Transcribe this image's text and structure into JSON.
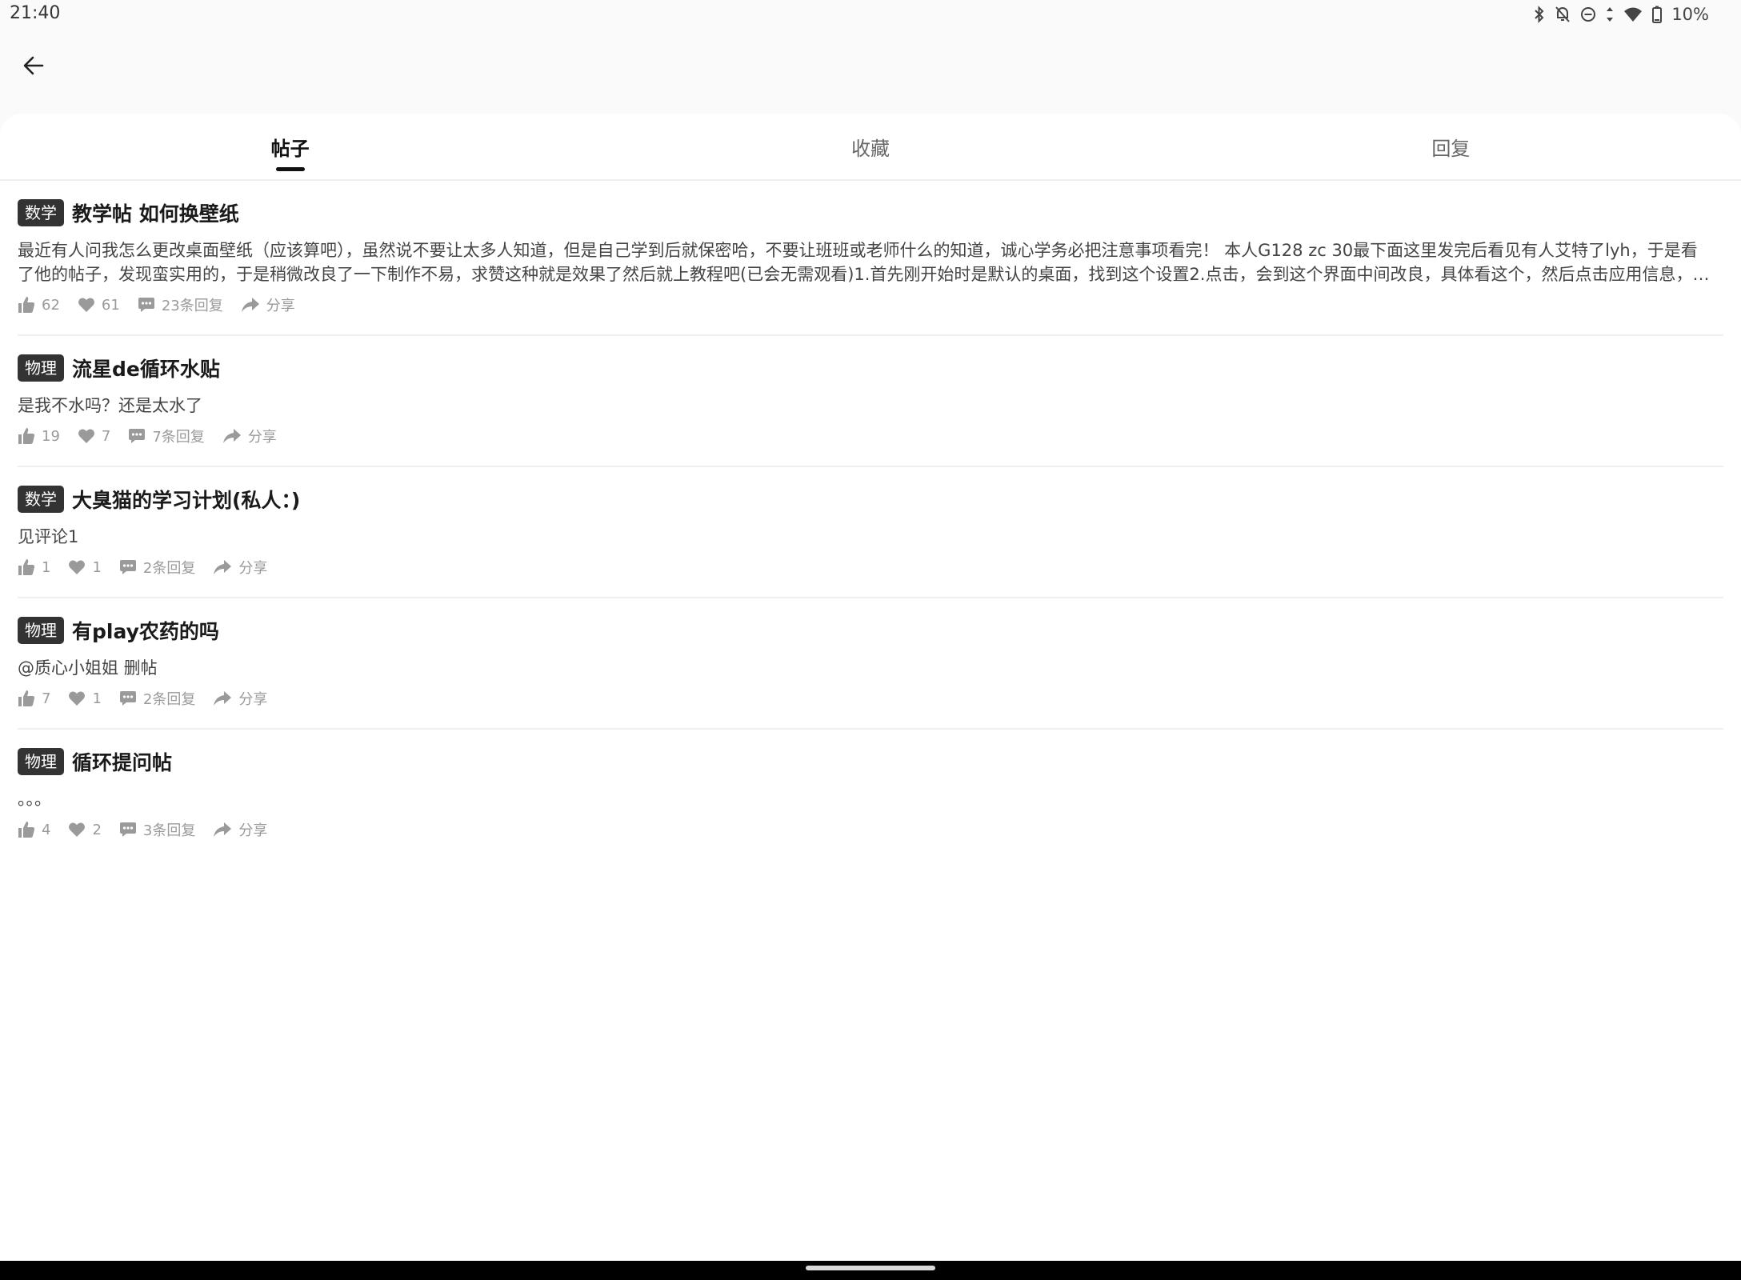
{
  "status_bar": {
    "time": "21:40",
    "battery_text": "10%",
    "icons": [
      "bluetooth-icon",
      "bell-off-icon",
      "do-not-disturb-icon",
      "data-arrows-icon",
      "wifi-icon",
      "battery-icon"
    ]
  },
  "app_bar": {
    "back_icon": "arrow-left-icon"
  },
  "tabs": [
    {
      "label": "帖子",
      "active": true
    },
    {
      "label": "收藏",
      "active": false
    },
    {
      "label": "回复",
      "active": false
    }
  ],
  "posts": [
    {
      "tag": "数学",
      "title": "教学帖  如何换壁纸",
      "body": "最近有人问我怎么更改桌面壁纸（应该算吧），虽然说不要让太多人知道，但是自己学到后就保密哈，不要让班班或老师什么的知道，诚心学务必把注意事项看完！   本人G128      zc 30最下面这里发完后看见有人艾特了lyh，于是看了他的帖子，发现蛮实用的，于是稍微改良了一下制作不易，求赞这种就是效果了然后就上教程吧(已会无需观看)1.首先刚开始时是默认的桌面，找到这个设置2.点击，会到这个界面中间改良，具体看这个，然后点击应用信息，就…",
      "likes": "62",
      "favorites": "61",
      "replies": "23条回复",
      "share": "分享"
    },
    {
      "tag": "物理",
      "title": "流星de循环水贴",
      "body": "是我不水吗？还是太水了",
      "likes": "19",
      "favorites": "7",
      "replies": "7条回复",
      "share": "分享"
    },
    {
      "tag": "数学",
      "title": "大臭猫的学习计划(私人：)",
      "body": "见评论1",
      "likes": "1",
      "favorites": "1",
      "replies": "2条回复",
      "share": "分享"
    },
    {
      "tag": "物理",
      "title": "有play农药的吗",
      "body": "@质心小姐姐  删帖",
      "likes": "7",
      "favorites": "1",
      "replies": "2条回复",
      "share": "分享"
    },
    {
      "tag": "物理",
      "title": "循环提问帖",
      "body": "。。。",
      "likes": "4",
      "favorites": "2",
      "replies": "3条回复",
      "share": "分享"
    }
  ],
  "action_icons": [
    "thumb-up-icon",
    "heart-icon",
    "comment-icon",
    "share-icon"
  ],
  "colors": {
    "tag_background": "#333333",
    "tab_indicator": "#111111",
    "meta_text": "#9a9a9a"
  }
}
